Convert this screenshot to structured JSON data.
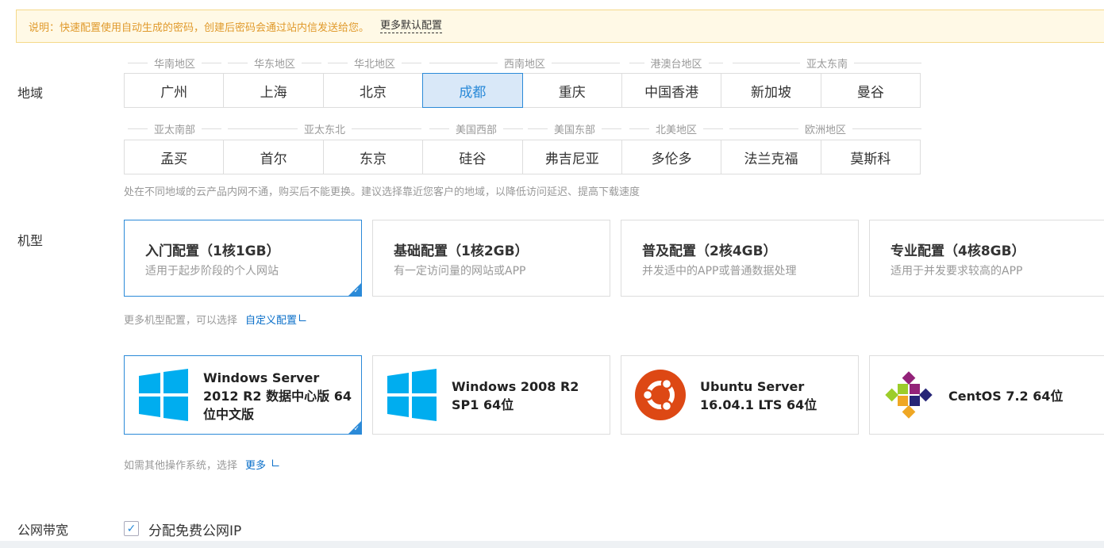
{
  "notice": {
    "text": "说明：快速配置使用自动生成的密码，创建后密码会通过站内信发送给您。",
    "more": "更多默认配置"
  },
  "region": {
    "label": "地域",
    "groups_row1": [
      "华南地区",
      "华东地区",
      "华北地区",
      "西南地区",
      "港澳台地区",
      "亚太东南"
    ],
    "regions_row1": [
      "广州",
      "上海",
      "北京",
      "成都",
      "重庆",
      "中国香港",
      "新加坡",
      "曼谷"
    ],
    "groups_row2": [
      "亚太南部",
      "亚太东北",
      "美国西部",
      "美国东部",
      "北美地区",
      "欧洲地区"
    ],
    "regions_row2": [
      "孟买",
      "首尔",
      "东京",
      "硅谷",
      "弗吉尼亚",
      "多伦多",
      "法兰克福",
      "莫斯科"
    ],
    "selected": "成都",
    "hint": "处在不同地域的云产品内网不通，购买后不能更换。建议选择靠近您客户的地域，以降低访问延迟、提高下载速度"
  },
  "model": {
    "label": "机型",
    "configs": [
      {
        "title": "入门配置（1核1GB）",
        "desc": "适用于起步阶段的个人网站"
      },
      {
        "title": "基础配置（1核2GB）",
        "desc": "有一定访问量的网站或APP"
      },
      {
        "title": "普及配置（2核4GB）",
        "desc": "并发适中的APP或普通数据处理"
      },
      {
        "title": "专业配置（4核8GB）",
        "desc": "适用于并发要求较高的APP"
      }
    ],
    "hint": "更多机型配置，可以选择",
    "hint_link": "自定义配置"
  },
  "os": {
    "items": [
      {
        "name": "Windows Server 2012 R2 数据中心版 64位中文版",
        "icon": "windows-icon"
      },
      {
        "name": "Windows 2008 R2 SP1 64位",
        "icon": "windows-icon"
      },
      {
        "name": "Ubuntu Server 16.04.1 LTS 64位",
        "icon": "ubuntu-icon"
      },
      {
        "name": "CentOS 7.2 64位",
        "icon": "centos-icon"
      }
    ],
    "hint": "如需其他操作系统，选择",
    "hint_link": "更多"
  },
  "bandwidth": {
    "label": "公网带宽",
    "checkbox_label": "分配免费公网IP",
    "checked": true
  },
  "colors": {
    "accent": "#2b8ad8",
    "link": "#0a6fc9",
    "notice_bg": "#fff9e6",
    "notice_text": "#e09a2c"
  }
}
